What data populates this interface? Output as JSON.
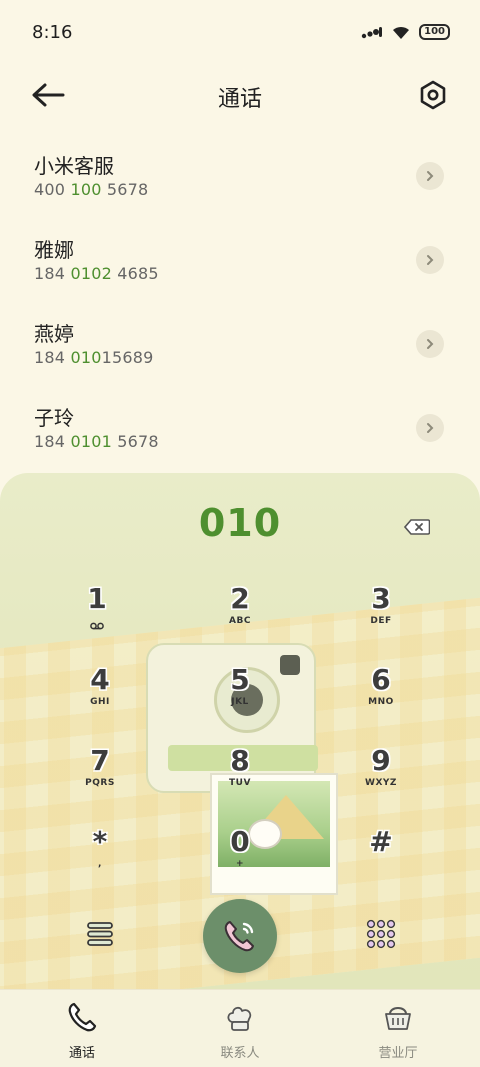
{
  "status_bar": {
    "time": "8:16",
    "battery": "100"
  },
  "header": {
    "title": "通话"
  },
  "contacts": [
    {
      "name": "小米客服",
      "num_pre": "400 ",
      "num_hl": "100",
      "num_post": " 5678"
    },
    {
      "name": "雅娜",
      "num_pre": "184 ",
      "num_hl": "0102",
      "num_post": " 4685"
    },
    {
      "name": "燕婷",
      "num_pre": "184 ",
      "num_hl": "010",
      "num_post": "15689"
    },
    {
      "name": "子玲",
      "num_pre": "184 ",
      "num_hl": "0101",
      "num_post": " 5678"
    }
  ],
  "dialer": {
    "input_value": "010",
    "keys": [
      {
        "digit": "1",
        "letters": ""
      },
      {
        "digit": "2",
        "letters": "ABC"
      },
      {
        "digit": "3",
        "letters": "DEF"
      },
      {
        "digit": "4",
        "letters": "GHI"
      },
      {
        "digit": "5",
        "letters": "JKL"
      },
      {
        "digit": "6",
        "letters": "MNO"
      },
      {
        "digit": "7",
        "letters": "PQRS"
      },
      {
        "digit": "8",
        "letters": "TUV"
      },
      {
        "digit": "9",
        "letters": "WXYZ"
      },
      {
        "digit": "*",
        "letters": ","
      },
      {
        "digit": "0",
        "letters": "+"
      },
      {
        "digit": "#",
        "letters": ""
      }
    ]
  },
  "bottom_nav": [
    {
      "label": "通话",
      "icon": "phone-icon",
      "active": true
    },
    {
      "label": "联系人",
      "icon": "chef-hat-icon",
      "active": false
    },
    {
      "label": "营业厅",
      "icon": "basket-icon",
      "active": false
    }
  ],
  "colors": {
    "accent": "#4e8f2f",
    "call_button": "#6c8f6a",
    "background": "#fbf7e6"
  }
}
